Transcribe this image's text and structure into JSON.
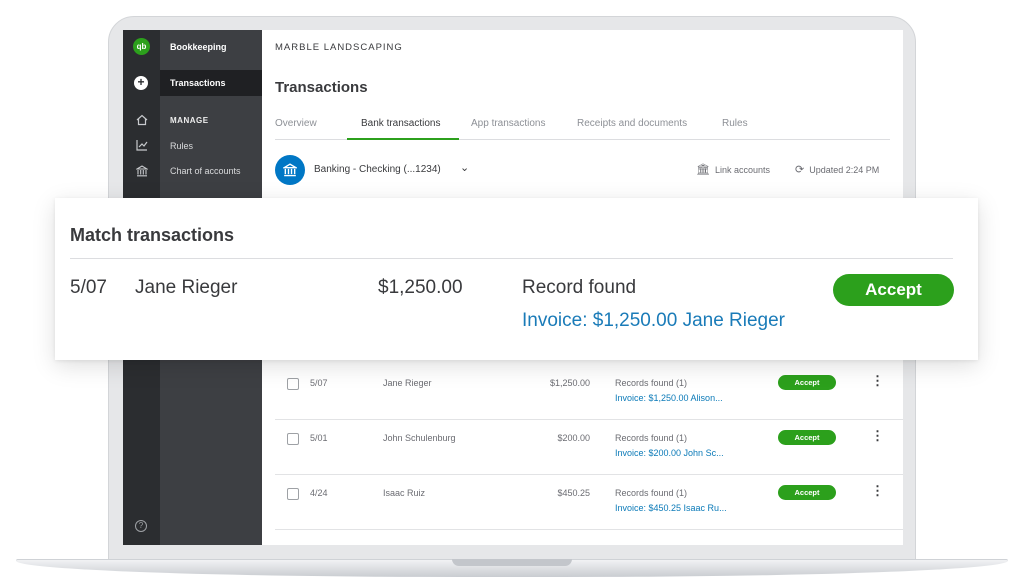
{
  "sidebar": {
    "app_title": "Bookkeeping",
    "active_item": "Transactions",
    "section_header": "MANAGE",
    "items": [
      "Rules",
      "Chart of accounts"
    ]
  },
  "header": {
    "company": "MARBLE LANDSCAPING",
    "page_title": "Transactions"
  },
  "tabs": [
    {
      "label": "Overview",
      "active": false
    },
    {
      "label": "Bank transactions",
      "active": true
    },
    {
      "label": "App transactions",
      "active": false
    },
    {
      "label": "Receipts and documents",
      "active": false
    },
    {
      "label": "Rules",
      "active": false
    }
  ],
  "account": {
    "name": "Banking - Checking (...1234)",
    "link_accounts": "Link accounts",
    "updated": "Updated 2:24 PM"
  },
  "match_card": {
    "title": "Match transactions",
    "date": "5/07",
    "name": "Jane Rieger",
    "amount": "$1,250.00",
    "status": "Record found",
    "link": "Invoice: $1,250.00 Jane Rieger",
    "accept_label": "Accept"
  },
  "rows": [
    {
      "date": "5/07",
      "name": "Jane Rieger",
      "amount": "$1,250.00",
      "status": "Records found (1)",
      "link": "Invoice: $1,250.00 Alison...",
      "accept": "Accept"
    },
    {
      "date": "5/01",
      "name": "John Schulenburg",
      "amount": "$200.00",
      "status": "Records found (1)",
      "link": "Invoice: $200.00 John Sc...",
      "accept": "Accept"
    },
    {
      "date": "4/24",
      "name": "Isaac Ruiz",
      "amount": "$450.25",
      "status": "Records found (1)",
      "link": "Invoice: $450.25 Isaac Ru...",
      "accept": "Accept"
    }
  ],
  "colors": {
    "accent_green": "#2ca01c",
    "link_blue": "#0b7ab8",
    "sidebar_dark": "#2b2d30",
    "bank_icon_blue": "#0077c5"
  },
  "icons": {
    "logo": "qb-logo-icon",
    "new": "plus-icon",
    "home": "home-icon",
    "chart": "chart-icon",
    "bank": "bank-icon",
    "help": "help-icon",
    "refresh": "refresh-icon",
    "more": "kebab-icon"
  }
}
